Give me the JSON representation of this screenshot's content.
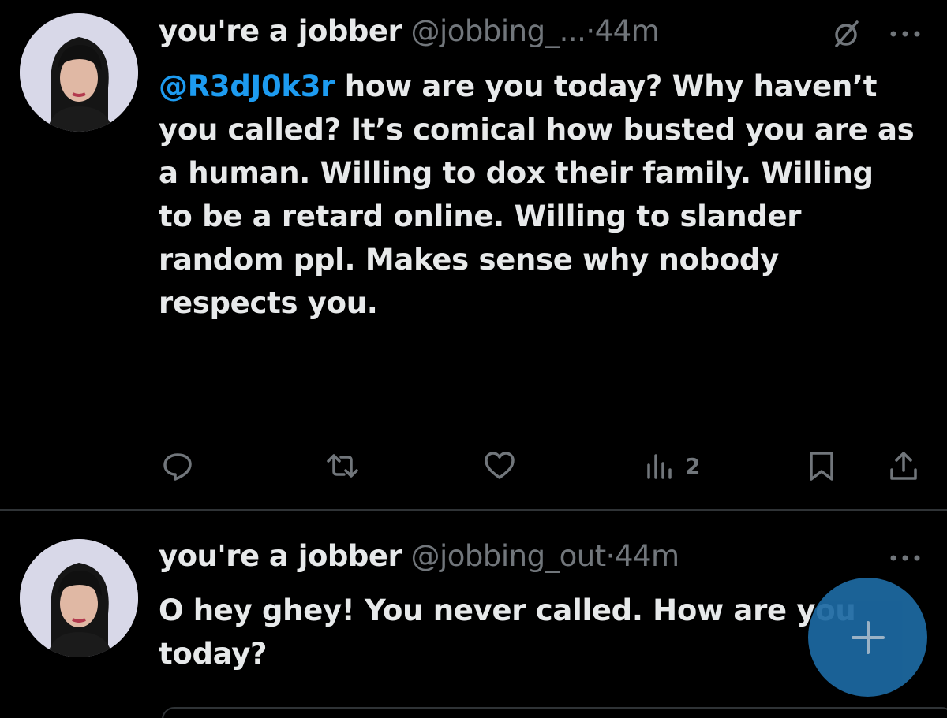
{
  "tweets": [
    {
      "display_name": "you're a jobber",
      "handle": "@jobbing_...",
      "separator": "·",
      "time": "44m",
      "mention": "@R3dJ0k3r",
      "text": " how are you today? Why haven’t you called? It’s comical how busted you are as a human. Willing to dox their family. Willing to be a retard online. Willing to slander random ppl. Makes sense why nobody respects you.",
      "views": "2",
      "icons": [
        "avatar",
        "grok-icon",
        "more-icon",
        "reply-icon",
        "retweet-icon",
        "like-icon",
        "views-icon",
        "bookmark-icon",
        "share-icon"
      ]
    },
    {
      "display_name": "you're a jobber",
      "handle": "@jobbing_out",
      "separator": "·",
      "time": "44m",
      "text": "O hey ghey! You never called. How are you today?",
      "icons": [
        "avatar",
        "more-icon"
      ]
    }
  ],
  "fab": {
    "icon": "plus-icon"
  },
  "colors": {
    "background": "#000000",
    "text": "#e7e9ea",
    "muted": "#71767b",
    "accent": "#1d9bf0",
    "divider": "#2f3336",
    "fab": "#1d6aa3"
  }
}
